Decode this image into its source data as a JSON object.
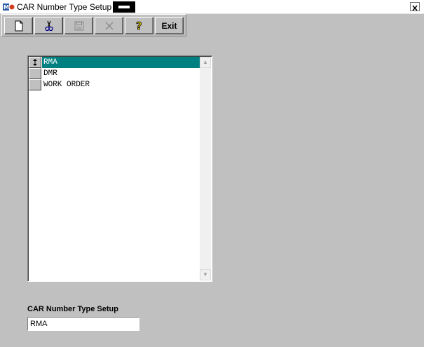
{
  "window": {
    "title": "CAR Number Type Setup",
    "close_glyph": "✕",
    "app_icon": "m-logo-icon"
  },
  "toolbar": {
    "buttons": [
      {
        "name": "new-button",
        "icon": "new-document-icon",
        "enabled": true
      },
      {
        "name": "cut-button",
        "icon": "scissors-icon",
        "enabled": true
      },
      {
        "name": "save-button",
        "icon": "floppy-disk-icon",
        "enabled": false
      },
      {
        "name": "delete-button",
        "icon": "x-icon",
        "enabled": false
      },
      {
        "name": "help-button",
        "icon": "question-mark-icon",
        "enabled": true
      }
    ],
    "exit_label": "Exit"
  },
  "list": {
    "items": [
      {
        "label": "RMA",
        "selected": true
      },
      {
        "label": "DMR",
        "selected": false
      },
      {
        "label": "WORK ORDER",
        "selected": false
      }
    ]
  },
  "form": {
    "field_label": "CAR Number Type Setup",
    "field_value": "RMA"
  },
  "colors": {
    "background": "#c0c0c0",
    "selection": "#008080"
  }
}
